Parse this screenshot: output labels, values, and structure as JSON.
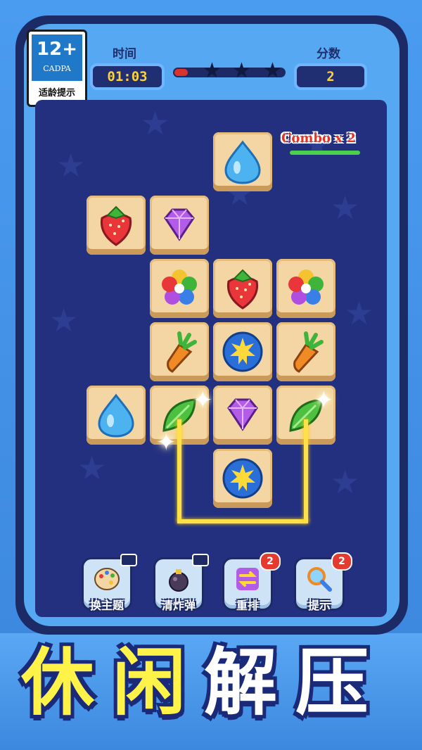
{
  "age_rating": {
    "number": "12+",
    "org": "CADPA",
    "text": "适龄提示"
  },
  "header": {
    "time_label": "时间",
    "time_value": "01:03",
    "score_label": "分数",
    "score_value": "2",
    "progress_fraction": 0.12
  },
  "combo": {
    "text": "Combo x 2"
  },
  "tools": [
    {
      "label": "换主题",
      "icon": "palette-icon",
      "badge": "",
      "video": true
    },
    {
      "label": "清炸弹",
      "icon": "bomb-icon",
      "badge": "",
      "video": true
    },
    {
      "label": "重排",
      "icon": "shuffle-icon",
      "badge": "2",
      "video": false
    },
    {
      "label": "提示",
      "icon": "magnifier-icon",
      "badge": "2",
      "video": false
    }
  ],
  "slogan": [
    "休",
    "闲",
    "解",
    "压"
  ],
  "tiles": [
    "water-drop",
    "strawberry",
    "diamond",
    "flower",
    "strawberry",
    "flower",
    "carrot",
    "sun",
    "carrot",
    "water-drop",
    "leaf",
    "diamond",
    "leaf",
    "sun"
  ]
}
